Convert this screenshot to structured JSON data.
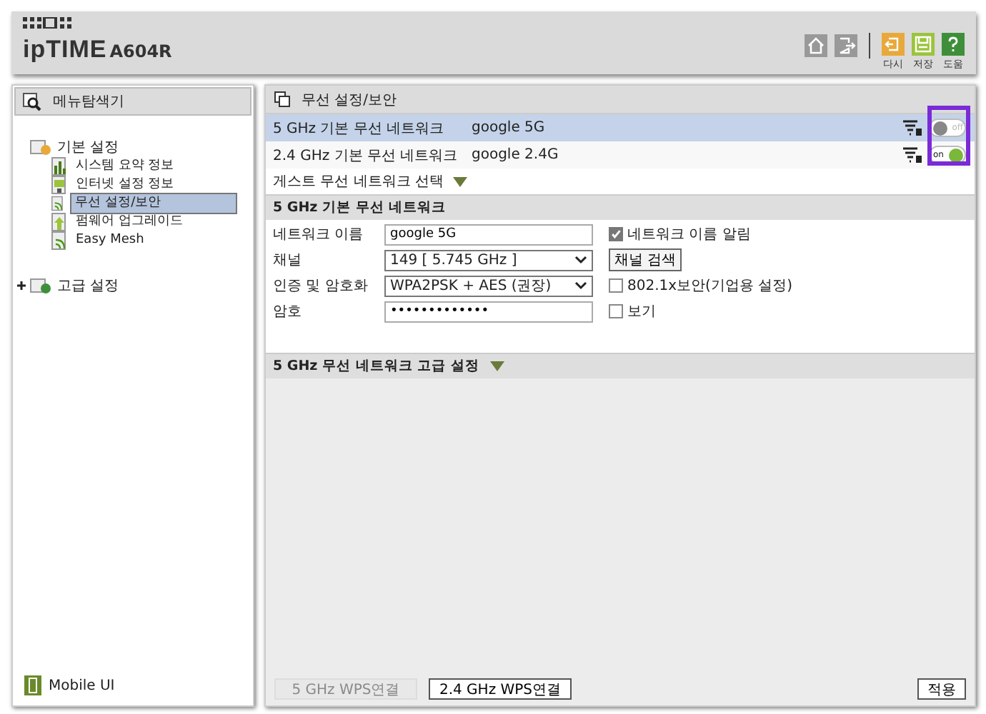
{
  "header": {
    "brand": "ipTIME",
    "model": "A604R",
    "tools": [
      {
        "kind": "home"
      },
      {
        "kind": "logout"
      }
    ],
    "actions": [
      {
        "kind": "reset",
        "label": "다시",
        "color": "#e8a93a"
      },
      {
        "kind": "save",
        "label": "저장",
        "color": "#9bc43c"
      },
      {
        "kind": "help",
        "label": "도움",
        "color": "#3f8f3a"
      }
    ]
  },
  "sidebar": {
    "title": "메뉴탐색기",
    "tree": [
      {
        "label": "기본 설정",
        "expanded": true,
        "children": [
          {
            "label": "시스템 요약 정보",
            "kind": "chart",
            "selected": false
          },
          {
            "label": "인터넷 설정 정보",
            "kind": "monitor",
            "selected": false
          },
          {
            "label": "무선 설정/보안",
            "kind": "wifi",
            "selected": true
          },
          {
            "label": "펌웨어 업그레이드",
            "kind": "upgrade",
            "selected": false
          },
          {
            "label": "Easy Mesh",
            "kind": "wifi",
            "selected": false
          }
        ]
      },
      {
        "label": "고급 설정",
        "expanded": false
      }
    ],
    "footer": "Mobile UI"
  },
  "panel": {
    "title": "무선 설정/보안",
    "networks": [
      {
        "label": "5 GHz 기본 무선 네트워크",
        "ssid": "google 5G",
        "selected": true,
        "on": false,
        "toggle_text": "off"
      },
      {
        "label": "2.4 GHz 기본 무선 네트워크",
        "ssid": "google 2.4G",
        "selected": false,
        "on": true,
        "toggle_text": "on"
      }
    ],
    "guest": "게스트 무선 네트워크 선택",
    "section": "5 GHz 기본 무선 네트워크",
    "fields": [
      {
        "label": "네트워크 이름",
        "kind": "text",
        "value": "google 5G",
        "side": {
          "kind": "checkbox",
          "label": "네트워크 이름 알림",
          "checked": true
        }
      },
      {
        "label": "채널",
        "kind": "select",
        "value": "149 [ 5.745 GHz ]",
        "side": {
          "kind": "button",
          "label": "채널 검색"
        }
      },
      {
        "label": "인증 및 암호화",
        "kind": "select",
        "value": "WPA2PSK + AES (권장)",
        "side": {
          "kind": "checkbox",
          "label": "802.1x보안(기업용 설정)",
          "checked": false
        }
      },
      {
        "label": "암호",
        "kind": "password",
        "value": "•••••••••••••",
        "side": {
          "kind": "checkbox",
          "label": "보기",
          "checked": false
        }
      }
    ],
    "advanced": "5 GHz 무선 네트워크 고급 설정",
    "buttons": [
      {
        "label": "5 GHz WPS연결",
        "disabled": true
      },
      {
        "label": "2.4 GHz WPS연결",
        "disabled": false
      }
    ],
    "apply": "적용"
  }
}
